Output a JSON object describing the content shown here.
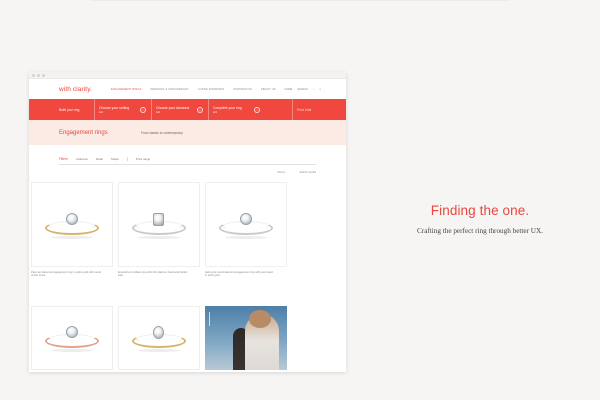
{
  "brand": {
    "logo": "with clarity.",
    "accent": "#f0483e",
    "soft_bg": "#fcebe4"
  },
  "nav": {
    "links": [
      "Engagement Rings",
      "Wedding & Anniversary",
      "Loose Diamonds",
      "Inspiration",
      "About Us"
    ],
    "right": [
      "Home",
      "Search"
    ]
  },
  "steps": {
    "start": "Build your ring",
    "items": [
      {
        "title": "Choose your setting",
        "sub": "Edit"
      },
      {
        "title": "Choose your diamond",
        "sub": "Edit"
      },
      {
        "title": "Complete your ring",
        "sub": "Edit"
      }
    ],
    "end": "Price total"
  },
  "hero": {
    "title": "Engagement rings",
    "subtitle": "From classic to contemporary"
  },
  "filters": {
    "items": [
      "Filters",
      "Collection",
      "Metal",
      "Shape",
      "Price range"
    ]
  },
  "sort": {
    "items": [
      "Sort by",
      "Search results"
    ]
  },
  "products": [
    {
      "title": "Pavé set diamond engagement ring in yellow gold with round center stone",
      "metal_color": "#d5b56a"
    },
    {
      "title": "Emerald cut solitaire ring with thin platinum band and hidden halo",
      "metal_color": "#c7cbd0"
    },
    {
      "title": "Halo style round diamond engagement ring with pavé band in white gold",
      "metal_color": "#c7cbd0"
    },
    {
      "title": "",
      "metal_color": "#e2a58a"
    },
    {
      "title": "",
      "metal_color": "#d5b56a"
    }
  ],
  "tagline": {
    "title": "Finding the one.",
    "subtitle": "Crafting the perfect ring through better UX."
  }
}
